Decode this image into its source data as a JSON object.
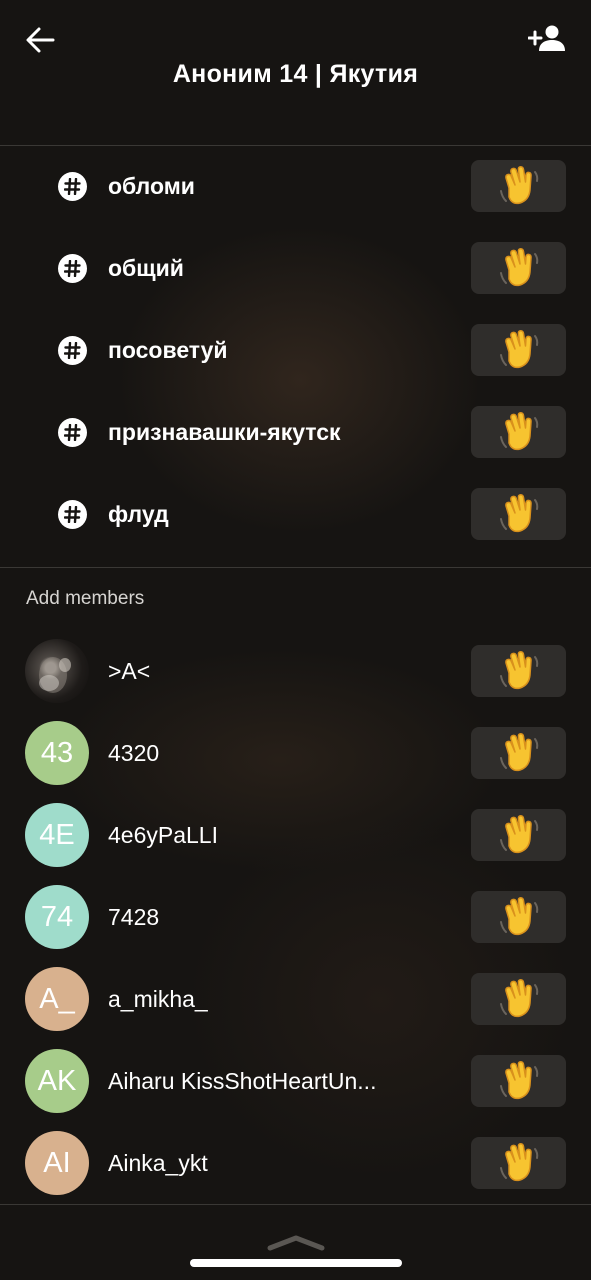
{
  "header": {
    "title": "Аноним 14 | Якутия",
    "back_icon": "arrow-left-icon",
    "add_user_icon": "person-add-icon"
  },
  "channels": [
    {
      "label": "обломи"
    },
    {
      "label": "общий"
    },
    {
      "label": "посоветуй"
    },
    {
      "label": "признавашки-якутск"
    },
    {
      "label": "флуд"
    }
  ],
  "add_members": {
    "section_label": "Add members",
    "members": [
      {
        "name": ">A<",
        "initials": "",
        "avatar_color": "#1e1b19",
        "photo": true
      },
      {
        "name": "4320",
        "initials": "43",
        "avatar_color": "#a7cc8a"
      },
      {
        "name": "4e6yPaLLI",
        "initials": "4E",
        "avatar_color": "#9fdccb"
      },
      {
        "name": "7428",
        "initials": "74",
        "avatar_color": "#9fdccb"
      },
      {
        "name": "a_mikha_",
        "initials": "A_",
        "avatar_color": "#d8b18e"
      },
      {
        "name": "Aiharu KissShotHeartUn...",
        "initials": "AK",
        "avatar_color": "#a7cc8a"
      },
      {
        "name": "Ainka_ykt",
        "initials": "AI",
        "avatar_color": "#d8b18e"
      }
    ]
  },
  "wave_button_icon": "waving-hand-icon",
  "colors": {
    "background": "#161412",
    "button_bg": "#2f2d2b",
    "divider": "#3a3835"
  }
}
